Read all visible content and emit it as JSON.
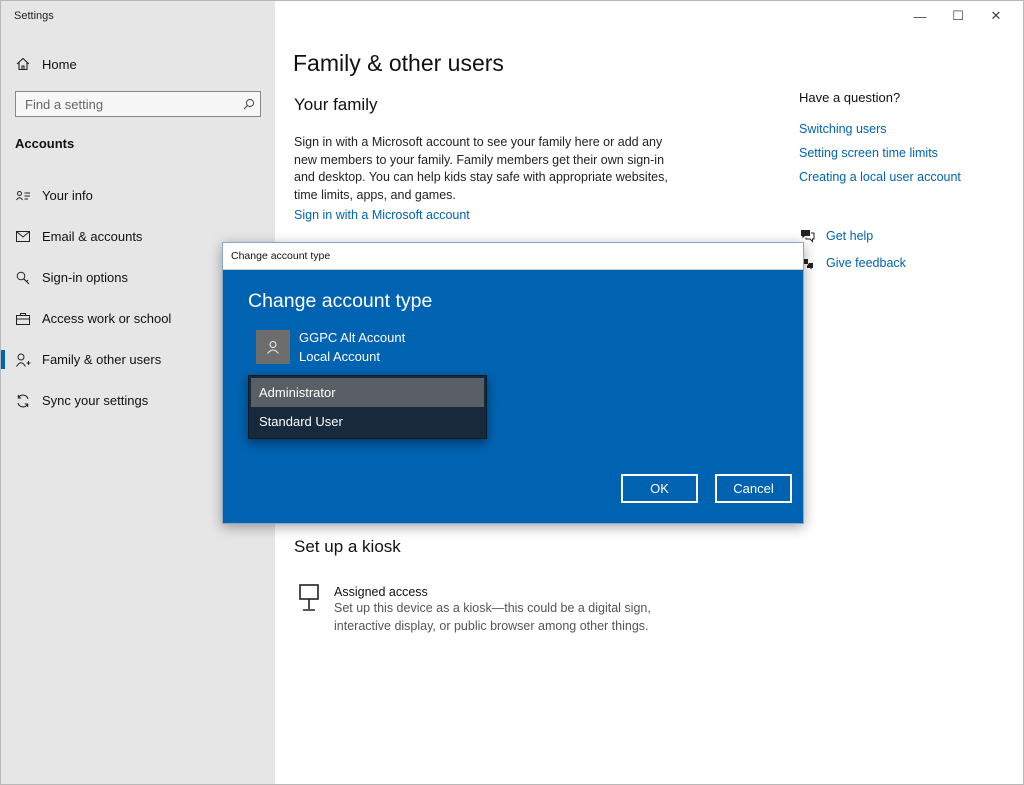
{
  "window": {
    "title": "Settings"
  },
  "window_controls": {
    "minimize": "—",
    "maximize": "☐",
    "close": "✕"
  },
  "sidebar": {
    "home_label": "Home",
    "search_placeholder": "Find a setting",
    "section": "Accounts",
    "items": [
      {
        "label": "Your info",
        "icon": "person-card-icon"
      },
      {
        "label": "Email & accounts",
        "icon": "mail-icon"
      },
      {
        "label": "Sign-in options",
        "icon": "key-icon"
      },
      {
        "label": "Access work or school",
        "icon": "briefcase-icon"
      },
      {
        "label": "Family & other users",
        "icon": "person-add-icon",
        "active": true
      },
      {
        "label": "Sync your settings",
        "icon": "sync-icon"
      }
    ]
  },
  "main": {
    "title": "Family & other users",
    "family_heading": "Your family",
    "family_desc": "Sign in with a Microsoft account to see your family here or add any new members to your family. Family members get their own sign-in and desktop. You can help kids stay safe with appropriate websites, time limits, apps, and games.",
    "signin_link": "Sign in with a Microsoft account",
    "kiosk_heading": "Set up a kiosk",
    "kiosk_title": "Assigned access",
    "kiosk_desc": "Set up this device as a kiosk—this could be a digital sign, interactive display, or public browser among other things."
  },
  "help": {
    "question": "Have a question?",
    "links": [
      "Switching users",
      "Setting screen time limits",
      "Creating a local user account"
    ],
    "get_help": "Get help",
    "give_feedback": "Give feedback"
  },
  "dialog": {
    "titlebar": "Change account type",
    "heading": "Change account type",
    "account_name": "GGPC Alt Account",
    "account_type": "Local Account",
    "options": [
      "Administrator",
      "Standard User"
    ],
    "selected": "Administrator",
    "ok": "OK",
    "cancel": "Cancel"
  },
  "colors": {
    "accent": "#0063b1",
    "sidebar_bg": "#e6e6e6",
    "dropdown_bg": "#162a3c",
    "option_selected": "#5a5f66"
  }
}
